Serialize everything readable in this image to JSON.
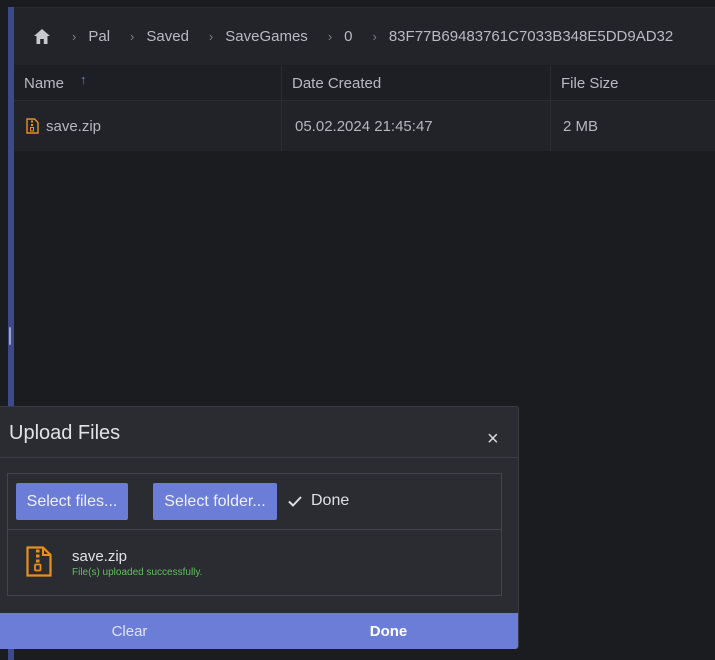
{
  "breadcrumb": {
    "home_icon": "home-icon",
    "items": [
      "Pal",
      "Saved",
      "SaveGames",
      "0",
      "83F77B69483761C7033B348E5DD9AD32"
    ]
  },
  "table": {
    "columns": {
      "name": "Name",
      "date": "Date Created",
      "size": "File Size"
    },
    "sort_icon": "arrow-up-icon",
    "rows": [
      {
        "name": "save.zip",
        "date": "05.02.2024 21:45:47",
        "size": "2 MB",
        "icon": "zip-file-icon"
      }
    ]
  },
  "dialog": {
    "title": "Upload Files",
    "close_symbol": "×",
    "select_files_label": "Select files...",
    "select_folder_label": "Select folder...",
    "status_label": "Done",
    "item": {
      "name": "save.zip",
      "status": "File(s) uploaded successfully."
    },
    "footer": {
      "clear_label": "Clear",
      "done_label": "Done"
    }
  },
  "colors": {
    "accent": "#6b7dd6",
    "success": "#5fbf5a",
    "file_icon": "#e8901e",
    "background": "#1b1c20"
  }
}
